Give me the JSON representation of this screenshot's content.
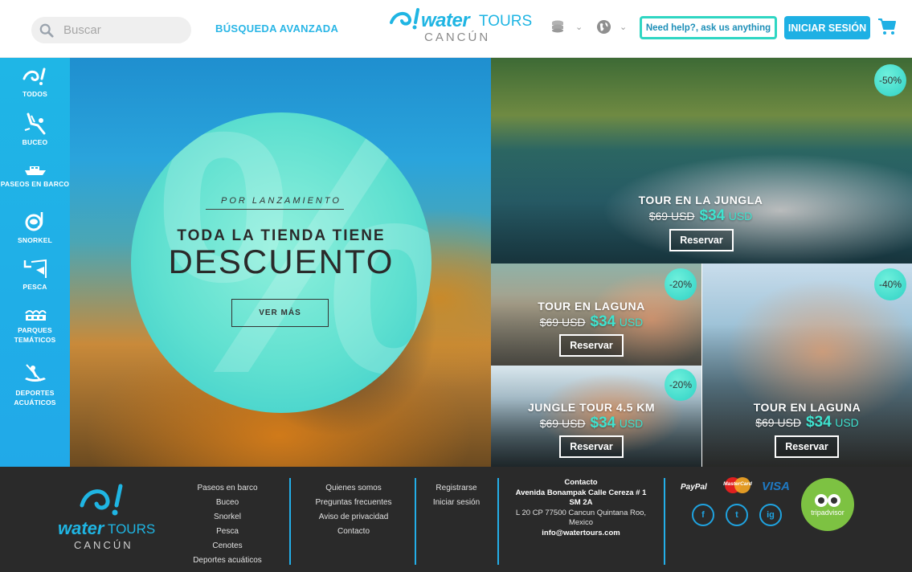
{
  "header": {
    "search_placeholder": "Buscar",
    "advanced_search": "BÚSQUEDA AVANZADA",
    "logo_water": "water",
    "logo_tours": "TOURS",
    "logo_city": "CANCÚN",
    "help": "Need help?, ask us anything",
    "login": "INICIAR SESIÓN"
  },
  "sidebar": {
    "items": [
      {
        "label": "TODOS",
        "icon": "water-logo-icon"
      },
      {
        "label": "BUCEO",
        "icon": "diver-icon"
      },
      {
        "label": "PASEOS EN BARCO",
        "icon": "boat-icon"
      },
      {
        "label": "SNORKEL",
        "icon": "snorkel-icon"
      },
      {
        "label": "PESCA",
        "icon": "fishing-icon"
      },
      {
        "label": "PARQUES TEMÁTICOS",
        "icon": "theme-park-icon"
      },
      {
        "label": "DEPORTES ACUÁTICOS",
        "icon": "kayak-icon"
      }
    ]
  },
  "hero": {
    "big_symbol": "%",
    "subtitle": "POR LANZAMIENTO",
    "title_line1": "TODA LA TIENDA TIENE",
    "title_line2": "DESCUENTO",
    "cta": "VER MÁS"
  },
  "tiles": [
    {
      "title": "TOUR EN LA JUNGLA",
      "old_price": "$69 USD",
      "new_price": "$34",
      "currency": "USD",
      "discount": "-50%",
      "button": "Reservar"
    },
    {
      "title": "TOUR EN LAGUNA",
      "old_price": "$69 USD",
      "new_price": "$34",
      "currency": "USD",
      "discount": "-20%",
      "button": "Reservar"
    },
    {
      "title": "TOUR EN LAGUNA",
      "old_price": "$69 USD",
      "new_price": "$34",
      "currency": "USD",
      "discount": "-40%",
      "button": "Reservar"
    },
    {
      "title": "JUNGLE TOUR 4.5 KM",
      "old_price": "$69 USD",
      "new_price": "$34",
      "currency": "USD",
      "discount": "-20%",
      "button": "Reservar"
    }
  ],
  "footer": {
    "logo_water": "water",
    "logo_tours": "TOURS",
    "logo_city": "CANCÚN",
    "col1": [
      "Paseos en barco",
      "Buceo",
      "Snorkel",
      "Pesca",
      "Cenotes",
      "Deportes acuáticos"
    ],
    "col2": [
      "Quienes somos",
      "Preguntas frecuentes",
      "Aviso de privacidad",
      "Contacto"
    ],
    "col3": [
      "Registrarse",
      "Iniciar sesión"
    ],
    "contact": {
      "heading": "Contacto",
      "address1": "Avenida Bonampak Calle Cereza # 1 SM 2A",
      "address2": "L 20 CP 77500 Cancun Quintana Roo, Mexico",
      "email": "info@watertours.com"
    },
    "payments": {
      "paypal": "PayPal",
      "mastercard": "MasterCard",
      "visa": "VISA"
    },
    "social": {
      "facebook": "f",
      "twitter": "t",
      "instagram": "ig"
    },
    "tripadvisor": "tripadvisor"
  },
  "colors": {
    "accent": "#1fb5e3",
    "turquoise": "#3fe3cf",
    "footer_bg": "#2a2a2a"
  }
}
